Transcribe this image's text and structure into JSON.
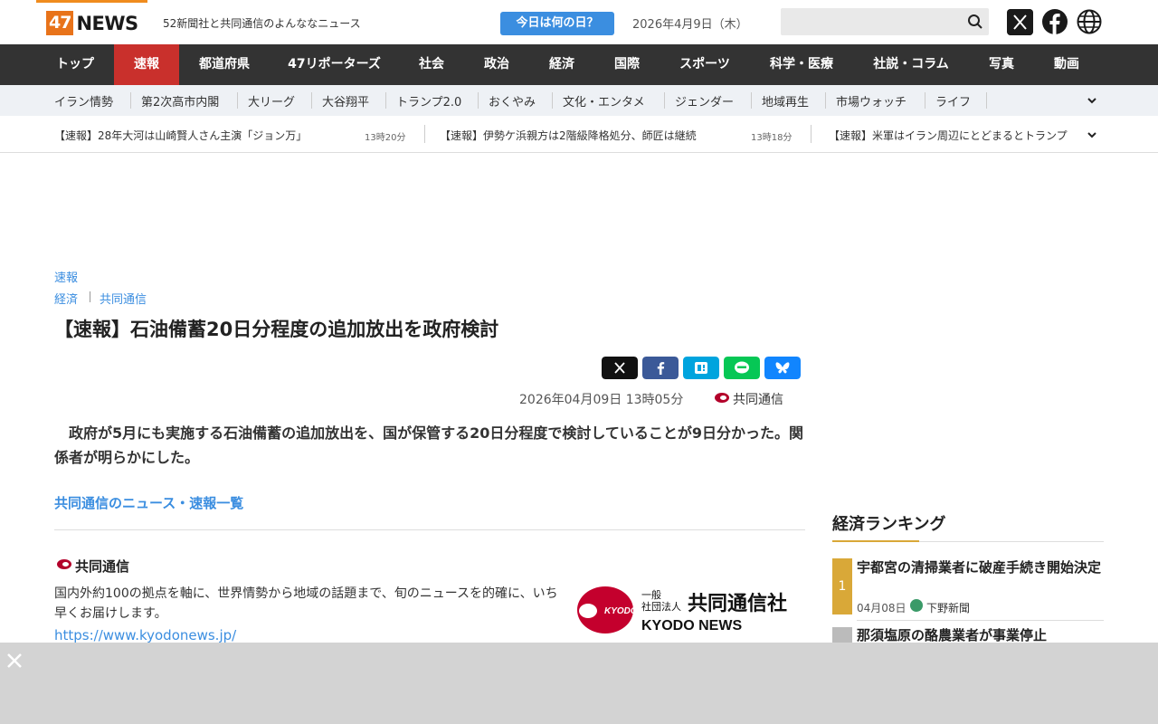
{
  "header": {
    "logo_num": "47",
    "logo_word": "NEWS",
    "tagline": "52新聞社と共同通信のよんななニュース",
    "today_button": "今日は何の日？",
    "date": "2026年4月9日（木）",
    "search_placeholder": ""
  },
  "main_nav": [
    "トップ",
    "速報",
    "都道府県",
    "47リポーターズ",
    "社会",
    "政治",
    "経済",
    "国際",
    "スポーツ",
    "科学・医療",
    "社説・コラム",
    "写真",
    "動画"
  ],
  "sub_nav": [
    "イラン情勢",
    "第2次高市内閣",
    "大リーグ",
    "大谷翔平",
    "トランプ2.0",
    "おくやみ",
    "文化・エンタメ",
    "ジェンダー",
    "地域再生",
    "市場ウォッチ",
    "ライフ"
  ],
  "ticker": [
    {
      "text": "【速報】28年大河は山崎賢人さん主演「ジョン万」",
      "time": "13時20分"
    },
    {
      "text": "【速報】伊勢ケ浜親方は2階級降格処分、師匠は継続",
      "time": "13時18分"
    },
    {
      "text": "【速報】米軍はイラン周辺にとどまるとトランプ",
      "time": ""
    }
  ],
  "article": {
    "category": "速報",
    "section": "経済",
    "source_link": "共同通信",
    "title": "【速報】石油備蓄20日分程度の追加放出を政府検討",
    "date": "2026年04月09日 13時05分",
    "source": "共同通信",
    "body": "　政府が5月にも実施する石油備蓄の追加放出を、国が保管する20日分程度で検討していることが9日分かった。関係者が明らかにした。",
    "list_link": "共同通信のニュース・速報一覧"
  },
  "source_box": {
    "name": "共同通信",
    "description": "国内外約100の拠点を軸に、世界情勢から地域の話題まで、旬のニュースを的確に、いち早くお届けします。",
    "url": "https://www.kyodonews.jp/",
    "logo_small1": "一般",
    "logo_small2": "社団法人",
    "logo_big": "共同通信社",
    "logo_en": "KYODO NEWS",
    "logo_circle": "KYODO"
  },
  "ranking": {
    "title": "経済ランキング",
    "items": [
      {
        "rank": "1",
        "title": "宇都宮の清掃業者に破産手続き開始決定",
        "date": "04月08日",
        "paper": "下野新聞"
      },
      {
        "rank": "2",
        "title": "那須塩原の酪農業者が事業停止",
        "date": "",
        "paper": ""
      }
    ]
  },
  "colors": {
    "accent": "#3b8ee0",
    "nav_bg": "#333333",
    "active_red": "#c9302c",
    "logo_orange": "#e8731a",
    "rank_gold": "#d9a838"
  }
}
